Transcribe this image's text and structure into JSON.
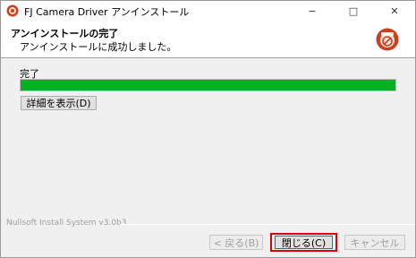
{
  "window": {
    "title": "FJ Camera Driver アンインストール",
    "controls": {
      "minimize": "−",
      "maximize": "□",
      "close": "✕"
    }
  },
  "header": {
    "title": "アンインストールの完了",
    "subtitle": "アンインストールに成功しました。"
  },
  "progress": {
    "label": "完了",
    "value_percent": 100,
    "color": "#06b025"
  },
  "buttons": {
    "details": "詳細を表示(D)",
    "back": "< 戻る(B)",
    "close": "閉じる(C)",
    "cancel": "キャンセル"
  },
  "branding": "Nullsoft Install System v3.0b3",
  "highlight_color": "#e00000"
}
